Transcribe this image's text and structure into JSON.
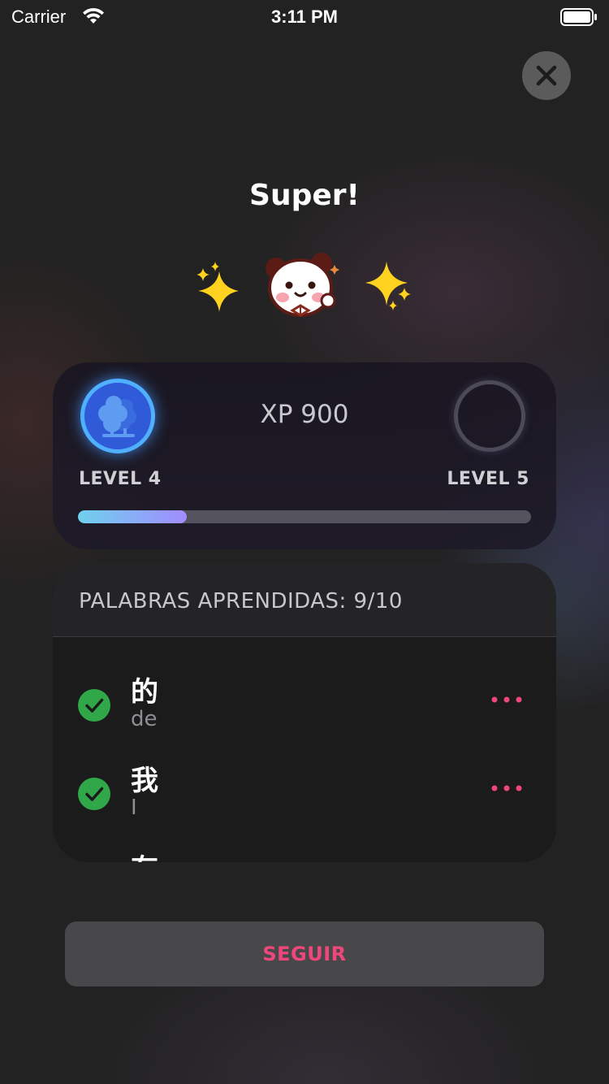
{
  "status_bar": {
    "carrier": "Carrier",
    "time": "3:11 PM"
  },
  "header": {
    "title": "Super!"
  },
  "level_card": {
    "xp_text": "XP 900",
    "current_level_label": "LEVEL 4",
    "next_level_label": "LEVEL 5",
    "progress_fraction": 0.24,
    "current_badge_icon": "tree-icon",
    "progress_colors": [
      "#6fd1ee",
      "#a18cff"
    ]
  },
  "words_card": {
    "title": "PALABRAS APRENDIDAS: 9/10",
    "words": [
      {
        "hanzi": "的",
        "meaning": "de",
        "learned": true
      },
      {
        "hanzi": "我",
        "meaning": "I",
        "learned": true
      },
      {
        "hanzi": "有",
        "meaning": "",
        "learned": true
      }
    ]
  },
  "footer": {
    "continue_label": "SEGUIR"
  },
  "colors": {
    "accent": "#f0477a",
    "check_green": "#30a84a",
    "badge_blue": "#2f5ad8"
  }
}
